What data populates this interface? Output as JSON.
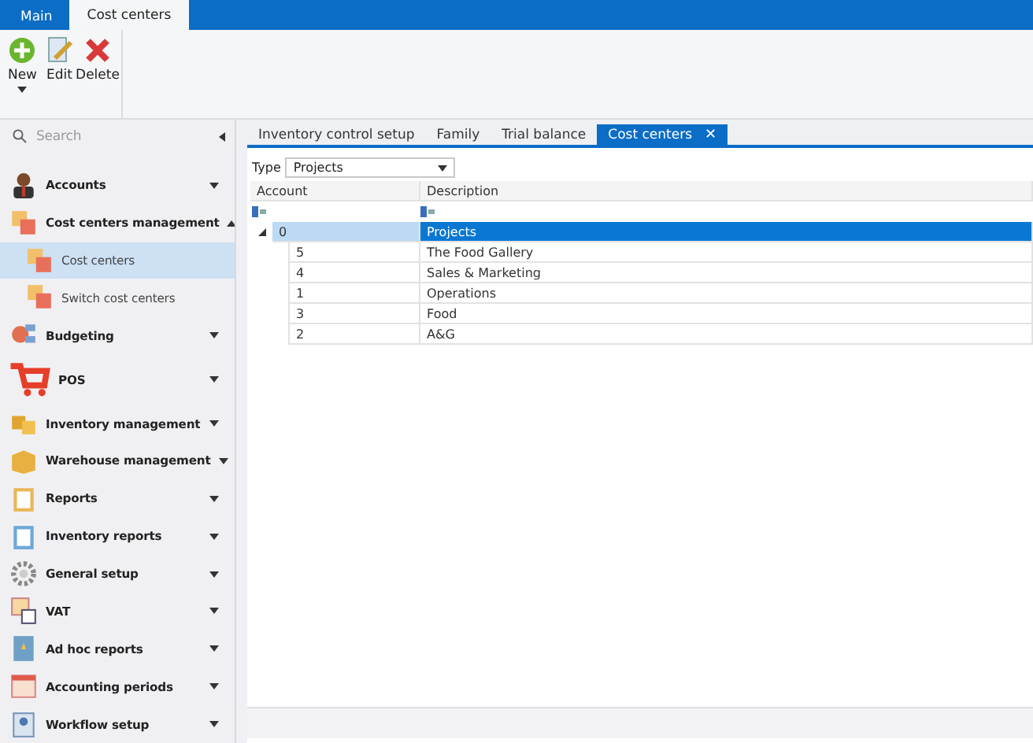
{
  "ribbon_tabs": [
    {
      "label": "Main",
      "selected": false
    },
    {
      "label": "Cost centers",
      "selected": true
    }
  ],
  "ribbon_buttons": [
    {
      "label": "New",
      "has_dropdown": true
    },
    {
      "label": "Edit",
      "has_dropdown": false
    },
    {
      "label": "Delete",
      "has_dropdown": false
    }
  ],
  "sidebar": {
    "search": {
      "placeholder": "Search"
    },
    "items": [
      {
        "label": "Accounts",
        "expanded": false,
        "selected": false
      },
      {
        "label": "Cost centers management",
        "expanded": true,
        "selected": false,
        "children": [
          {
            "label": "Cost centers",
            "selected": true
          },
          {
            "label": "Switch cost centers",
            "selected": false
          }
        ]
      },
      {
        "label": "Budgeting",
        "expanded": false,
        "selected": false
      },
      {
        "label": "POS",
        "expanded": false,
        "selected": false
      },
      {
        "label": "Inventory management",
        "expanded": false,
        "selected": false
      },
      {
        "label": "Warehouse management",
        "expanded": false,
        "selected": false
      },
      {
        "label": "Reports",
        "expanded": false,
        "selected": false
      },
      {
        "label": "Inventory reports",
        "expanded": false,
        "selected": false
      },
      {
        "label": "General setup",
        "expanded": false,
        "selected": false
      },
      {
        "label": "VAT",
        "expanded": false,
        "selected": false
      },
      {
        "label": "Ad hoc reports",
        "expanded": false,
        "selected": false
      },
      {
        "label": "Accounting periods",
        "expanded": false,
        "selected": false
      },
      {
        "label": "Workflow setup",
        "expanded": false,
        "selected": false
      }
    ]
  },
  "doc_tabs": [
    {
      "label": "Inventory control setup",
      "selected": false,
      "closable": false
    },
    {
      "label": "Family",
      "selected": false,
      "closable": false
    },
    {
      "label": "Trial balance",
      "selected": false,
      "closable": false
    },
    {
      "label": "Cost centers",
      "selected": true,
      "closable": true
    }
  ],
  "close_glyph": "✕",
  "type_filter": {
    "label": "Type",
    "value": "Projects"
  },
  "table": {
    "columns": [
      "Account",
      "Description"
    ],
    "rows": [
      {
        "account": "0",
        "description": "Projects",
        "selected": true,
        "expanded": true,
        "children": [
          {
            "account": "5",
            "description": "The Food Gallery",
            "selected": false
          },
          {
            "account": "4",
            "description": "Sales & Marketing",
            "selected": false
          },
          {
            "account": "1",
            "description": "Operations",
            "selected": false
          },
          {
            "account": "3",
            "description": "Food",
            "selected": false
          },
          {
            "account": "2",
            "description": "A&G",
            "selected": false
          }
        ]
      }
    ]
  }
}
